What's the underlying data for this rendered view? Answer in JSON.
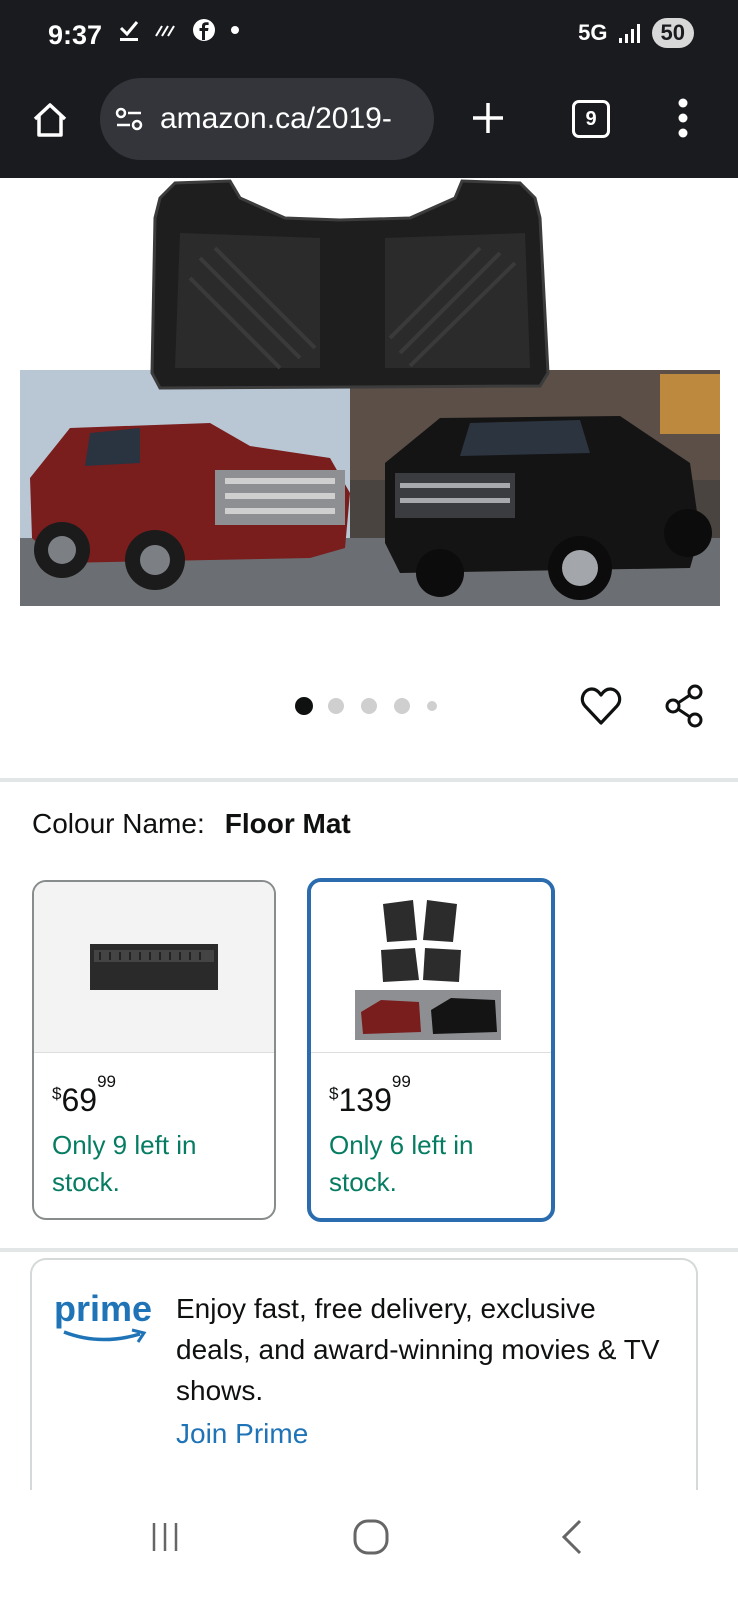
{
  "status_bar": {
    "time": "9:37",
    "network": "5G",
    "battery": "50"
  },
  "browser": {
    "url": "amazon.ca/2019-",
    "tab_count": "9"
  },
  "gallery": {
    "total_images": 5,
    "current_index": 1
  },
  "variation": {
    "label": "Colour Name:",
    "value": "Floor Mat"
  },
  "options": [
    {
      "price_whole": "69",
      "price_fraction": "99",
      "currency": "$",
      "stock": "Only 9 left in stock.",
      "selected": false
    },
    {
      "price_whole": "139",
      "price_fraction": "99",
      "currency": "$",
      "stock": "Only 6 left in stock.",
      "selected": true
    }
  ],
  "prime": {
    "logo": "prime",
    "text": "Enjoy fast, free delivery, exclusive deals, and award-winning movies & TV shows.",
    "link": "Join Prime"
  },
  "colors": {
    "status_bg": "#1a1b1f",
    "selected_border": "#2a6cad",
    "stock_green": "#067d62",
    "prime_blue": "#1f73b7"
  }
}
